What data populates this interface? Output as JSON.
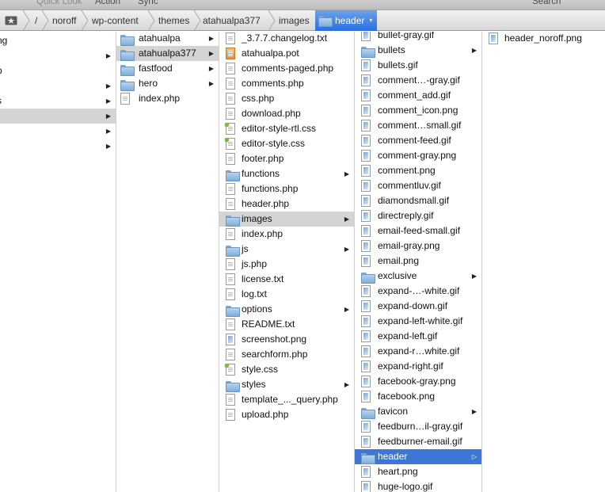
{
  "toolbar": {
    "quick_look": "Quick Look",
    "action": "Action",
    "sync": "Sync",
    "search": "Search"
  },
  "breadcrumbs": [
    "/",
    "noroff",
    "wp-content",
    "themes",
    "atahualpa377",
    "images",
    "header"
  ],
  "colors": {
    "selection_blue": "#3d76d4",
    "selection_gray": "#d4d4d4"
  },
  "col0": {
    "items": [
      {
        "label": "ng",
        "arrow": false
      },
      {
        "label": "",
        "arrow": true
      },
      {
        "label": "p",
        "arrow": false
      },
      {
        "label": "",
        "arrow": true
      },
      {
        "label": "s",
        "arrow": true
      },
      {
        "label": "",
        "arrow": true,
        "selected": true
      },
      {
        "label": "",
        "arrow": true
      },
      {
        "label": "",
        "arrow": true
      }
    ]
  },
  "col1": {
    "items": [
      {
        "label": "atahualpa",
        "icon": "folder-icon",
        "arrow": true
      },
      {
        "label": "atahualpa377",
        "icon": "folder-icon",
        "arrow": true,
        "selected": true
      },
      {
        "label": "fastfood",
        "icon": "folder-icon",
        "arrow": true
      },
      {
        "label": "hero",
        "icon": "folder-icon",
        "arrow": true
      },
      {
        "label": "index.php",
        "icon": "file-icon",
        "arrow": false
      }
    ]
  },
  "col2": {
    "items": [
      {
        "label": "_3.7.7.changelog.txt",
        "icon": "file-icon"
      },
      {
        "label": "atahualpa.pot",
        "icon": "pot-file-icon"
      },
      {
        "label": "comments-paged.php",
        "icon": "file-icon"
      },
      {
        "label": "comments.php",
        "icon": "file-icon"
      },
      {
        "label": "css.php",
        "icon": "file-icon"
      },
      {
        "label": "download.php",
        "icon": "file-icon"
      },
      {
        "label": "editor-style-rtl.css",
        "icon": "css-file-icon"
      },
      {
        "label": "editor-style.css",
        "icon": "css-file-icon"
      },
      {
        "label": "footer.php",
        "icon": "file-icon"
      },
      {
        "label": "functions",
        "icon": "folder-icon",
        "arrow": true
      },
      {
        "label": "functions.php",
        "icon": "file-icon"
      },
      {
        "label": "header.php",
        "icon": "file-icon"
      },
      {
        "label": "images",
        "icon": "folder-icon",
        "arrow": true,
        "selected": true
      },
      {
        "label": "index.php",
        "icon": "file-icon"
      },
      {
        "label": "js",
        "icon": "folder-icon",
        "arrow": true
      },
      {
        "label": "js.php",
        "icon": "file-icon"
      },
      {
        "label": "license.txt",
        "icon": "file-icon"
      },
      {
        "label": "log.txt",
        "icon": "file-icon"
      },
      {
        "label": "options",
        "icon": "folder-icon",
        "arrow": true
      },
      {
        "label": "README.txt",
        "icon": "file-icon"
      },
      {
        "label": "screenshot.png",
        "icon": "image-file-icon"
      },
      {
        "label": "searchform.php",
        "icon": "file-icon"
      },
      {
        "label": "style.css",
        "icon": "css-file-icon"
      },
      {
        "label": "styles",
        "icon": "folder-icon",
        "arrow": true
      },
      {
        "label": "template_..._query.php",
        "icon": "file-icon"
      },
      {
        "label": "upload.php",
        "icon": "file-icon"
      }
    ]
  },
  "col3": {
    "items": [
      {
        "label": "bullet-gray.gif",
        "icon": "image-file-icon"
      },
      {
        "label": "bullets",
        "icon": "folder-icon",
        "arrow": true
      },
      {
        "label": "bullets.gif",
        "icon": "image-file-icon"
      },
      {
        "label": "comment…-gray.gif",
        "icon": "image-file-icon"
      },
      {
        "label": "comment_add.gif",
        "icon": "image-file-icon"
      },
      {
        "label": "comment_icon.png",
        "icon": "image-file-icon"
      },
      {
        "label": "comment…small.gif",
        "icon": "image-file-icon"
      },
      {
        "label": "comment-feed.gif",
        "icon": "image-file-icon"
      },
      {
        "label": "comment-gray.png",
        "icon": "image-file-icon"
      },
      {
        "label": "comment.png",
        "icon": "image-file-icon"
      },
      {
        "label": "commentluv.gif",
        "icon": "image-file-icon"
      },
      {
        "label": "diamondsmall.gif",
        "icon": "image-file-icon"
      },
      {
        "label": "directreply.gif",
        "icon": "image-file-icon"
      },
      {
        "label": "email-feed-small.gif",
        "icon": "image-file-icon"
      },
      {
        "label": "email-gray.png",
        "icon": "image-file-icon"
      },
      {
        "label": "email.png",
        "icon": "image-file-icon"
      },
      {
        "label": "exclusive",
        "icon": "folder-icon",
        "arrow": true
      },
      {
        "label": "expand-…-white.gif",
        "icon": "image-file-icon"
      },
      {
        "label": "expand-down.gif",
        "icon": "image-file-icon"
      },
      {
        "label": "expand-left-white.gif",
        "icon": "image-file-icon"
      },
      {
        "label": "expand-left.gif",
        "icon": "image-file-icon"
      },
      {
        "label": "expand-r…white.gif",
        "icon": "image-file-icon"
      },
      {
        "label": "expand-right.gif",
        "icon": "image-file-icon"
      },
      {
        "label": "facebook-gray.png",
        "icon": "image-file-icon"
      },
      {
        "label": "facebook.png",
        "icon": "image-file-icon"
      },
      {
        "label": "favicon",
        "icon": "folder-icon",
        "arrow": true
      },
      {
        "label": "feedburn…il-gray.gif",
        "icon": "image-file-icon"
      },
      {
        "label": "feedburner-email.gif",
        "icon": "image-file-icon"
      },
      {
        "label": "header",
        "icon": "folder-icon",
        "arrow": true,
        "selected": true
      },
      {
        "label": "heart.png",
        "icon": "image-file-icon"
      },
      {
        "label": "huge-logo.gif",
        "icon": "image-file-icon"
      }
    ]
  },
  "col4": {
    "items": [
      {
        "label": "header_noroff.png",
        "icon": "image-file-icon"
      }
    ]
  }
}
